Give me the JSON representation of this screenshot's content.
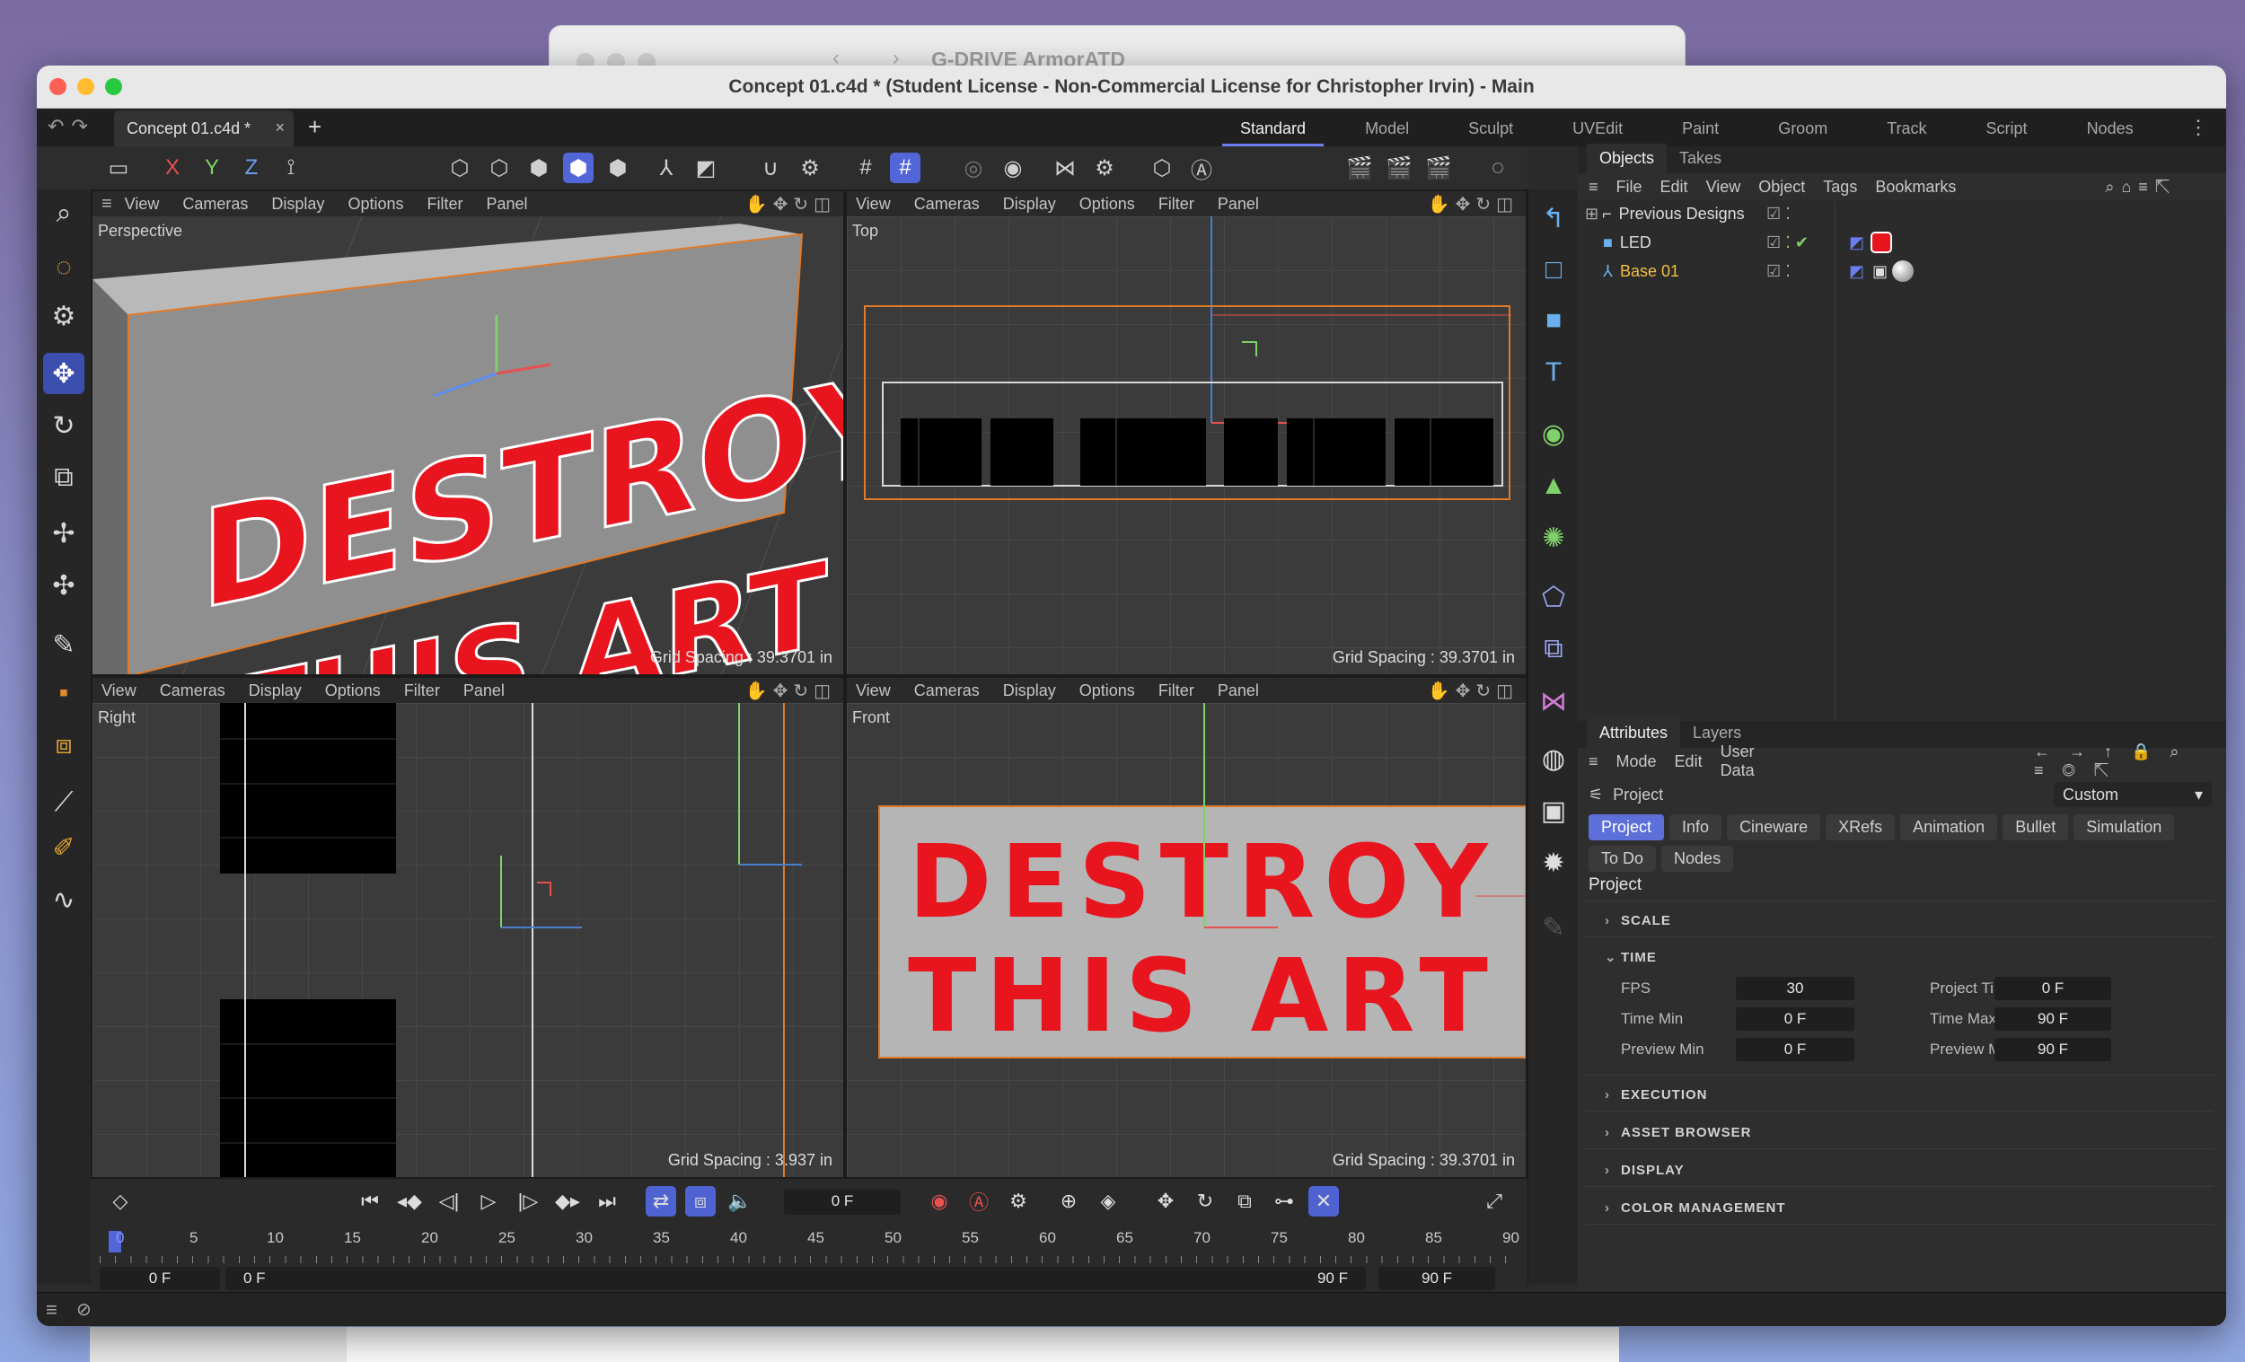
{
  "background_window": {
    "title": "G-DRIVE ArmorATD"
  },
  "window": {
    "title": "Concept 01.c4d * (Student License - Non-Commercial License for Christopher Irvin) - Main"
  },
  "doc_tab": {
    "label": "Concept 01.c4d *",
    "close": "×"
  },
  "layouts": [
    "Standard",
    "Model",
    "Sculpt",
    "UVEdit",
    "Paint",
    "Groom",
    "Track",
    "Script",
    "Nodes"
  ],
  "axes": {
    "x": "X",
    "y": "Y",
    "z": "Z"
  },
  "viewport_menu": [
    "View",
    "Cameras",
    "Display",
    "Options",
    "Filter",
    "Panel"
  ],
  "viewports": {
    "perspective": {
      "label": "Perspective",
      "grid": "Grid Spacing : 39.3701 in"
    },
    "top": {
      "label": "Top",
      "grid": "Grid Spacing : 39.3701 in"
    },
    "right": {
      "label": "Right",
      "grid": "Grid Spacing : 3.937 in"
    },
    "front": {
      "label": "Front",
      "grid": "Grid Spacing : 39.3701 in"
    }
  },
  "scene_text": {
    "line1": "DESTROY",
    "line2": "THIS ART"
  },
  "objects_panel": {
    "tabs": [
      "Objects",
      "Takes"
    ],
    "menu": [
      "File",
      "Edit",
      "View",
      "Object",
      "Tags",
      "Bookmarks"
    ],
    "items": [
      {
        "name": "Previous Designs"
      },
      {
        "name": "LED"
      },
      {
        "name": "Base 01"
      }
    ]
  },
  "attributes_panel": {
    "tabs": [
      "Attributes",
      "Layers"
    ],
    "menu": [
      "Mode",
      "Edit",
      "User Data"
    ],
    "object": "Project",
    "preset": "Custom",
    "buttons_row1": [
      "Project",
      "Info",
      "Cineware",
      "XRefs",
      "Animation",
      "Bullet",
      "Simulation"
    ],
    "buttons_row2": [
      "To Do",
      "Nodes"
    ],
    "heading": "Project",
    "sections": {
      "scale": "SCALE",
      "time": "TIME",
      "execution": "EXECUTION",
      "asset_browser": "ASSET BROWSER",
      "display": "DISPLAY",
      "color_management": "COLOR MANAGEMENT"
    },
    "time": {
      "fps_label": "FPS",
      "fps": "30",
      "project_time_label": "Project Time",
      "project_time": "0 F",
      "time_min_label": "Time Min",
      "time_min": "0 F",
      "time_max_label": "Time Max",
      "time_max": "90 F",
      "preview_min_label": "Preview Min",
      "preview_min": "0 F",
      "preview_max_label": "Preview Max",
      "preview_max": "90 F"
    }
  },
  "timeline": {
    "current_frame": "0 F",
    "ticks": [
      "0",
      "5",
      "10",
      "15",
      "20",
      "25",
      "30",
      "35",
      "40",
      "45",
      "50",
      "55",
      "60",
      "65",
      "70",
      "75",
      "80",
      "85",
      "90"
    ],
    "range_start_outer": "0 F",
    "range_start": "0 F",
    "range_end": "90 F",
    "range_end_outer": "90 F"
  },
  "colors": {
    "accent": "#5366d8",
    "scene_red": "#e8141e",
    "selection_orange": "#e07a2a"
  }
}
